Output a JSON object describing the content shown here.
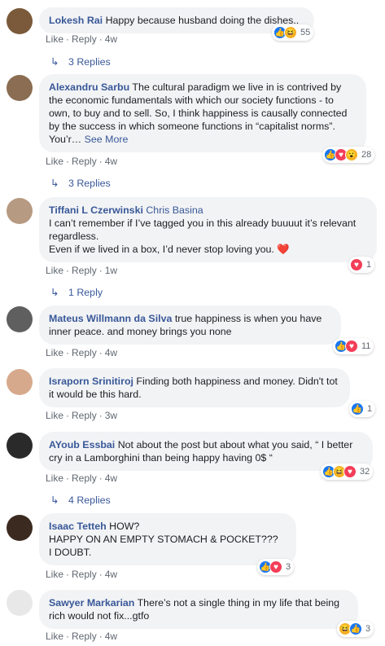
{
  "meta_labels": {
    "like": "Like",
    "reply": "Reply",
    "dot": "·"
  },
  "colors": {
    "author": "#385898",
    "bubble": "#f2f3f5",
    "meta": "#606770",
    "like": "#1877f2",
    "love": "#f33e58",
    "haha": "#f7b125"
  },
  "comments": [
    {
      "author": "Lokesh Rai",
      "text": "Happy because husband doing the dishes..",
      "time": "4w",
      "reactions": [
        "like-icon",
        "haha-icon"
      ],
      "reaction_count": "55",
      "replies": "3 Replies"
    },
    {
      "author": "Alexandru Sarbu",
      "text": "The cultural paradigm we live in is contrived by the economic fundamentals with which our society functions - to own, to buy and to sell. So, I think happiness is causally connected by the success in which someone functions in “capitalist norms”. You’r…",
      "see_more": "See More",
      "time": "4w",
      "reactions": [
        "like-icon",
        "love-icon",
        "wow-icon"
      ],
      "reaction_count": "28",
      "replies": "3 Replies"
    },
    {
      "author": "Tiffani L Czerwinski",
      "tag": "Chris Basina",
      "text_line1": "I can’t remember if I’ve tagged you in this already buuuut it’s relevant regardless.",
      "text_line2": "Even if we lived in a box, I’d never stop loving you.",
      "heart": "❤️",
      "time": "1w",
      "reactions": [
        "love-icon"
      ],
      "reaction_count": "1",
      "replies": "1 Reply"
    },
    {
      "author": "Mateus Willmann da Silva",
      "text": "true happiness is when you have inner peace. and money brings you none",
      "time": "4w",
      "reactions": [
        "like-icon",
        "love-icon"
      ],
      "reaction_count": "11"
    },
    {
      "author": "Israporn Srinitiroj",
      "text": "Finding both happiness and money. Didn't tot it would be this hard.",
      "time": "3w",
      "reactions": [
        "like-icon"
      ],
      "reaction_count": "1"
    },
    {
      "author": "AYoub Essbai",
      "text": "Not about the post but about what you said, “ I better cry in a Lamborghini than being happy having 0$ “",
      "time": "4w",
      "reactions": [
        "like-icon",
        "haha-icon",
        "love-icon"
      ],
      "reaction_count": "32",
      "replies": "4 Replies"
    },
    {
      "author": "Isaac Tetteh",
      "text_line1": "HOW?",
      "text_line2": "HAPPY ON AN EMPTY STOMACH & POCKET???",
      "text_line3": "I DOUBT.",
      "time": "4w",
      "reactions": [
        "like-icon",
        "love-icon"
      ],
      "reaction_count": "3"
    },
    {
      "author": "Sawyer Markarian",
      "text": "There’s not a single thing in my life that being rich would not fix...gtfo",
      "time": "4w",
      "reactions": [
        "haha-icon",
        "like-icon"
      ],
      "reaction_count": "3"
    }
  ]
}
